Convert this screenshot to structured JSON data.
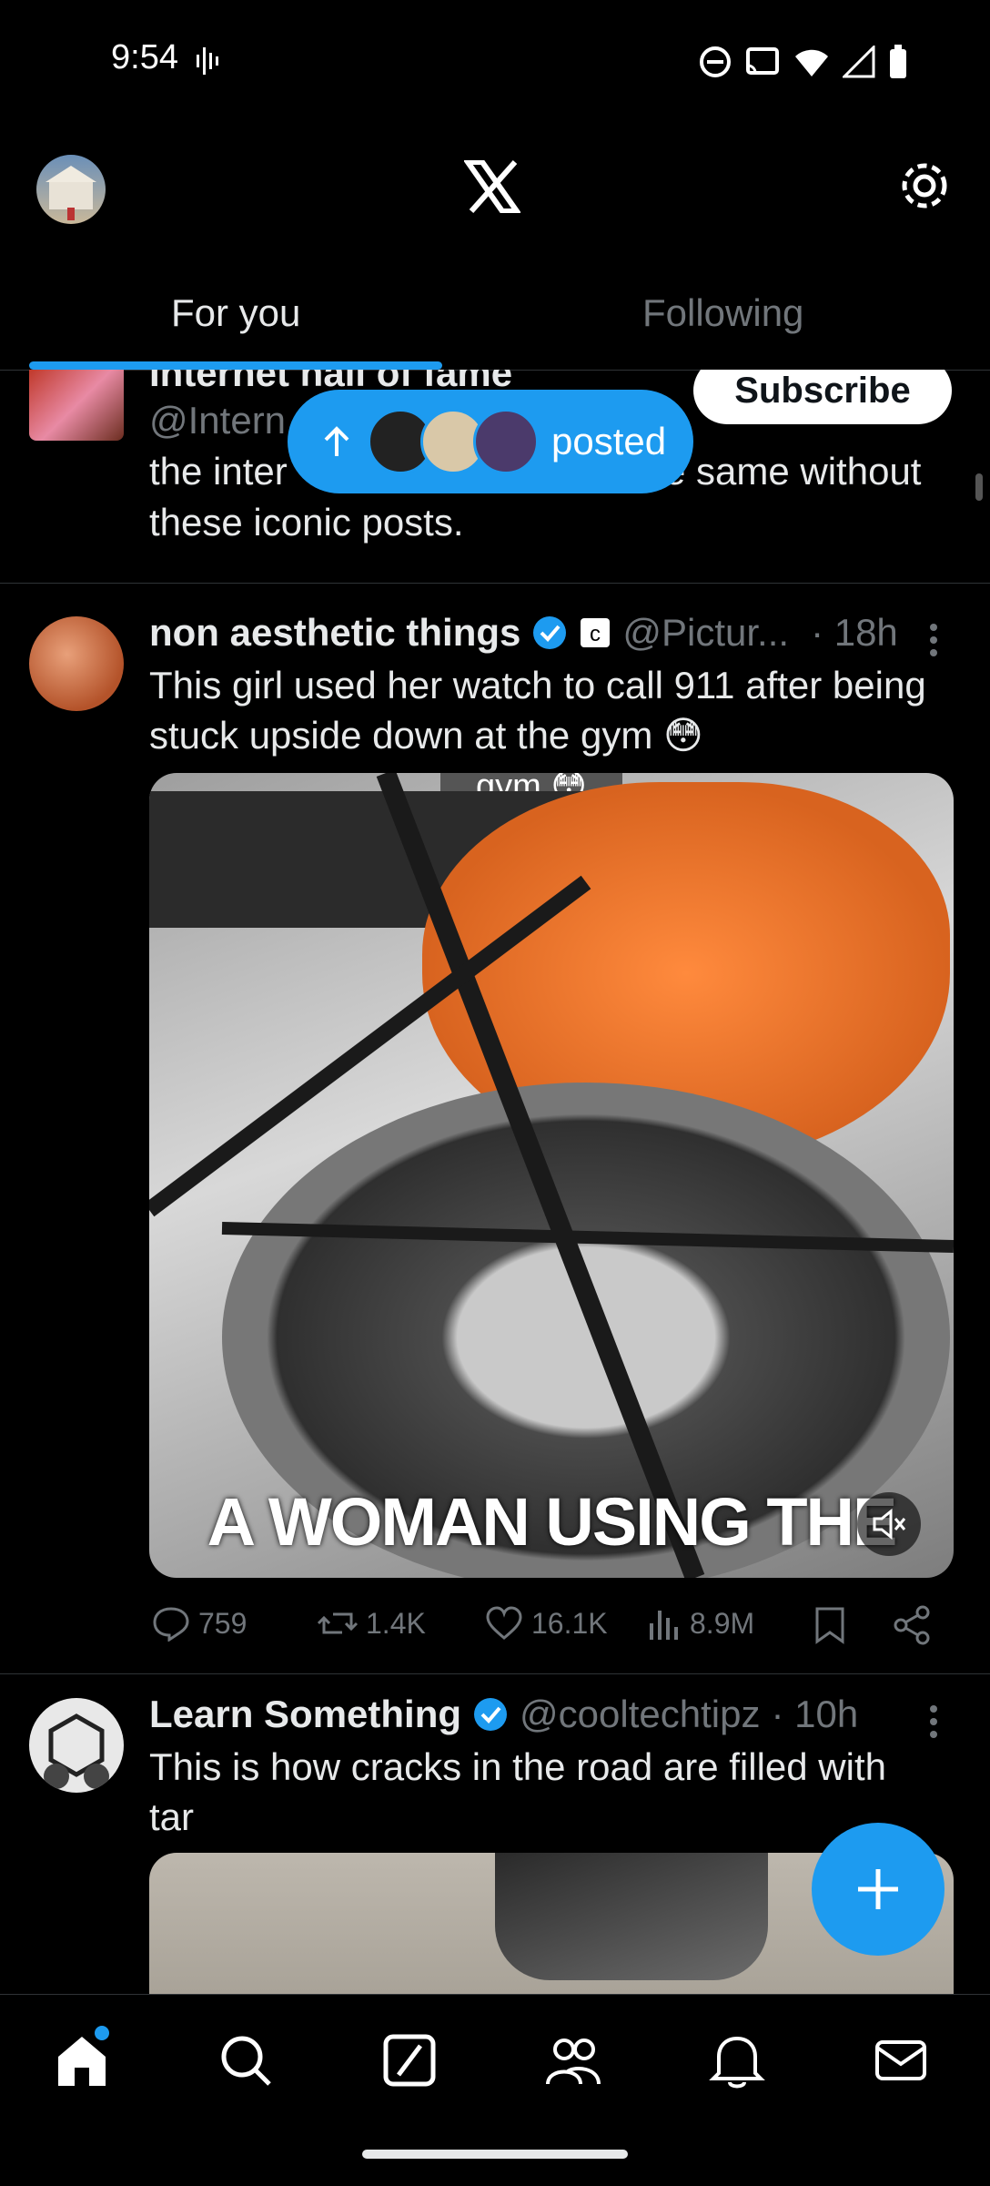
{
  "status_bar": {
    "time": "9:54"
  },
  "tabs": {
    "for_you": "For you",
    "following": "Following"
  },
  "posts": [
    {
      "name": "Internet hall of fame",
      "handle": "@Intern",
      "text": "the inter",
      "text_right": "e same without",
      "text2": "these iconic posts.",
      "subscribe_label": "Subscribe"
    },
    {
      "name": "non aesthetic things",
      "handle": "@Pictur...",
      "time": "· 18h",
      "text_line1": "This girl used her watch to call 911 after being",
      "text_line2": "stuck upside down at the gym 😳",
      "video_caption": "A WOMAN USING THE",
      "video_top_text": "gym 😳",
      "metrics": {
        "replies": "759",
        "reposts": "1.4K",
        "likes": "16.1K",
        "views": "8.9M"
      }
    },
    {
      "name": "Learn Something",
      "handle": "@cooltechtipz",
      "time": "· 10h",
      "text_line1": "This is how cracks in the road are filled with",
      "text_line2": "tar"
    }
  ],
  "new_posts_pill": {
    "label": "posted"
  }
}
